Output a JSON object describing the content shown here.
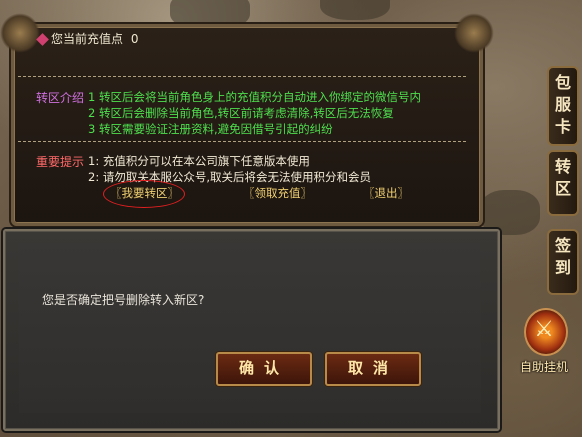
{
  "panel": {
    "charge_label": "您当前充值点",
    "charge_value": "0",
    "transfer_intro_label": "转区介绍",
    "transfer_lines": [
      "1 转区后会将当前角色身上的充值积分自动进入你绑定的微信号内",
      "2 转区后会删除当前角色,转区前请考虑清除,转区后无法恢复",
      "3 转区需要验证注册资料,避免因借号引起的纠纷"
    ],
    "important_label": "重要提示",
    "important_lines": [
      "1: 充值积分可以在本公司旗下任意版本使用",
      "2: 请勿取关本服公众号,取关后将会无法使用积分和会员"
    ],
    "links": {
      "transfer": "〖我要转区〗",
      "claim": "〖领取充值〗",
      "exit": "〖退出〗"
    }
  },
  "sidebar": {
    "tabs": [
      "包服卡",
      "转区",
      "签到"
    ],
    "auto_label": "自助挂机"
  },
  "dialog": {
    "message": "您是否确定把号删除转入新区?",
    "confirm_label": "确认",
    "cancel_label": "取消"
  }
}
